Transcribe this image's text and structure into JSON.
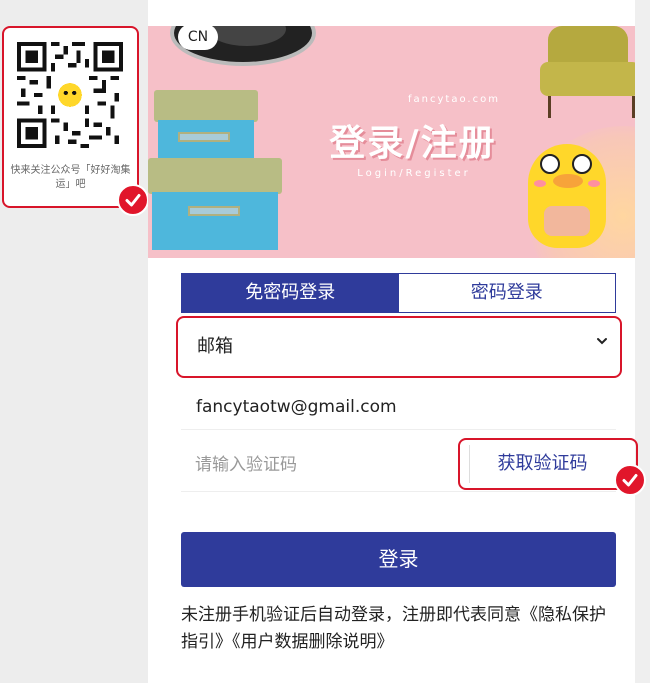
{
  "qr": {
    "caption": "快来关注公众号「好好淘集运」吧"
  },
  "banner": {
    "lang": "CN",
    "site": "fancytao.com",
    "title": "登录/注册",
    "subtitle": "Login/Register"
  },
  "tabs": [
    {
      "label": "免密码登录",
      "active": true
    },
    {
      "label": "密码登录",
      "active": false
    }
  ],
  "form": {
    "account_type": "邮箱",
    "email": "fancytaotw@gmail.com",
    "code_placeholder": "请输入验证码",
    "get_code_label": "获取验证码",
    "login_label": "登录"
  },
  "notice": {
    "text": "未注册手机验证后自动登录，注册即代表同意",
    "privacy_link": "《隐私保护指引》",
    "data_link": "《用户数据删除说明》"
  },
  "colors": {
    "primary": "#2f3b9b",
    "highlight": "#d8152a",
    "banner_bg": "#f6c0c8"
  }
}
